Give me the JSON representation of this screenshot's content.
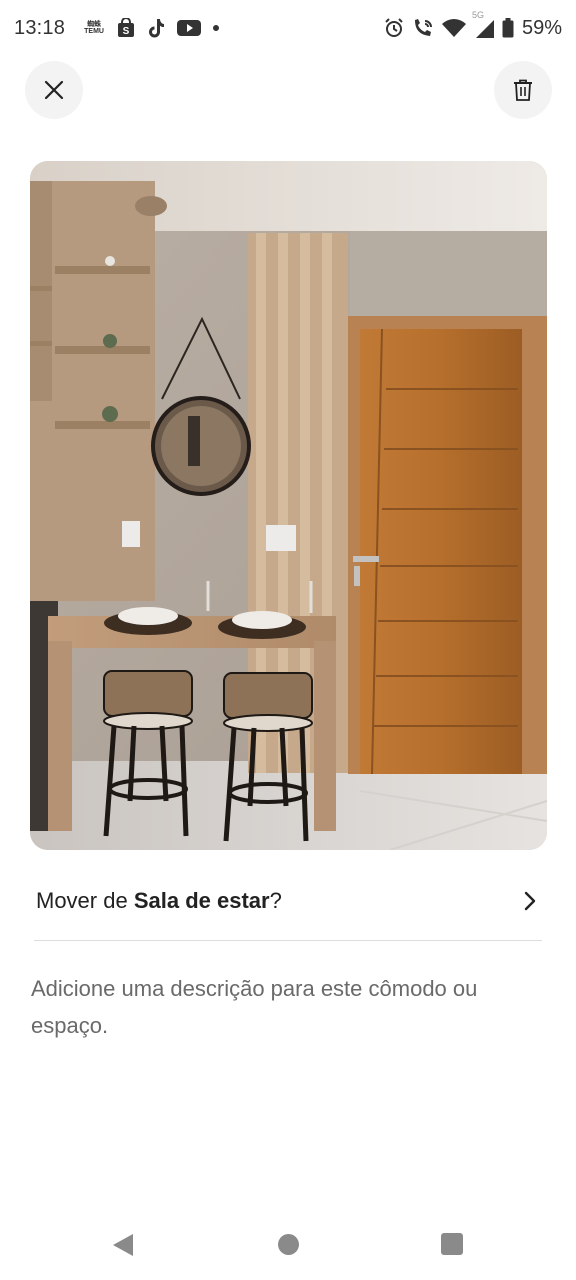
{
  "status_bar": {
    "time": "13:18",
    "temu_label_top": "蜘蛛",
    "temu_label_bottom": "TEMU",
    "battery": "59%",
    "network": "5G",
    "icons": [
      "temu-icon",
      "shopping-bag-icon",
      "tiktok-icon",
      "youtube-icon",
      "dot-icon",
      "alarm-icon",
      "wifi-call-icon",
      "wifi-icon",
      "signal-icon",
      "battery-icon"
    ]
  },
  "header": {
    "close_icon": "close-icon",
    "delete_icon": "trash-icon"
  },
  "photo": {
    "description_icon": "room-photo"
  },
  "room_row": {
    "prefix": "Mover de ",
    "room": "Sala de estar",
    "suffix": "?",
    "chevron_icon": "chevron-right-icon"
  },
  "description": {
    "text": "Adicione uma descrição para este cômodo ou espaço."
  },
  "nav_bar": {
    "back_icon": "back-icon",
    "home_icon": "home-icon",
    "recents_icon": "recents-icon"
  }
}
